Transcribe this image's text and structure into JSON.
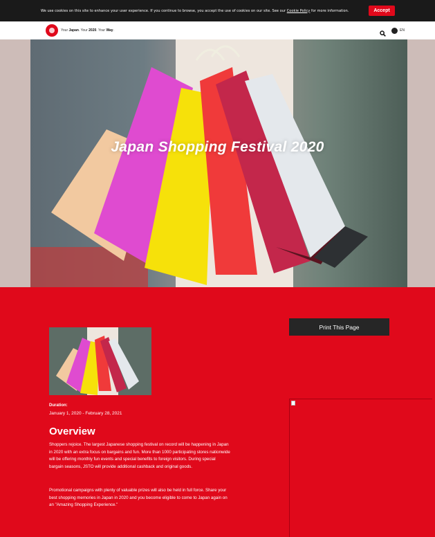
{
  "cookie_bar": {
    "text_before": "We use cookies on this site to enhance your user experience. If you continue to browse, you accept the use of cookies on our site. See our",
    "link": "Cookie Policy",
    "text_after": "for more information.",
    "accept_label": "Accept"
  },
  "header": {
    "tagline_your1": "Your ",
    "tagline_japan": "Japan",
    "tagline_your2": ". Your ",
    "tagline_year": "2020",
    "tagline_your3": ". Your ",
    "tagline_way": "Way",
    "tagline_end": ".",
    "language": "EN"
  },
  "hero": {
    "title": "Japan Shopping Festival 2020"
  },
  "main": {
    "duration_label": "Duration:",
    "duration_value": "January 1, 2020 - February 28, 2021",
    "overview_title": "Overview",
    "paragraph_1": "Shoppers rejoice. The largest Japanese shopping festival on record will be happening in Japan in 2020 with an extra focus on bargains and fun. More than 1000 participating stores nationwide will be offering monthly fun events and special benefits to foreign visitors. During special bargain seasons, JSTO will provide additional cashback and original goods.",
    "paragraph_2": "Promotional campaigns with plenty of valuable prizes will also be held in full force. Share your best shopping memories in Japan in 2020 and you become eligible to come to Japan again on an \"Amazing Shopping Experience.\"",
    "print_label": "Print This Page"
  },
  "colors": {
    "brand_red": "#e0091b",
    "cookie_bar": "#1a1a1a",
    "print_button": "#262626"
  },
  "icons": [
    "logo-icon",
    "search-icon",
    "globe-icon",
    "broken-image-icon"
  ]
}
